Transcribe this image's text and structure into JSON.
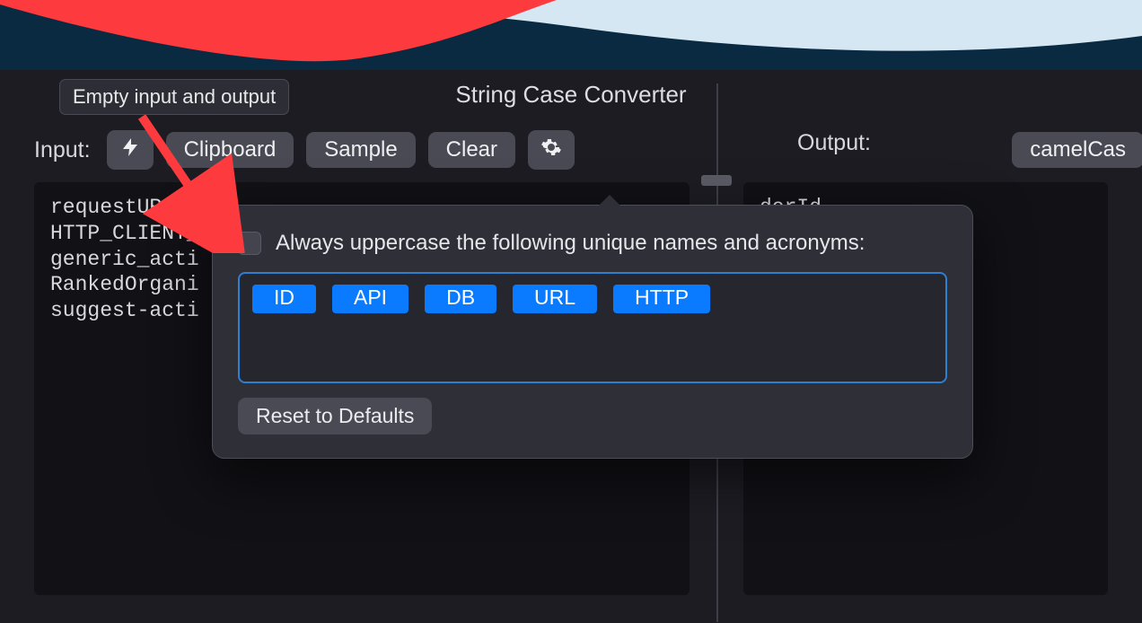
{
  "window": {
    "title": "String Case Converter"
  },
  "tooltip": "Empty input and output",
  "toolbar": {
    "input_label": "Input:",
    "clipboard": "Clipboard",
    "sample": "Sample",
    "clear": "Clear",
    "output_label": "Output:",
    "case_mode": "camelCas"
  },
  "icons": {
    "lightning": "lightning-icon",
    "gear": "gear-icon"
  },
  "input_text": "requestURLDe\nHTTP_CLIENT_\ngeneric_acti\nRankedOrgani\nsuggest-acti",
  "output_text": "derId\nry\nHighlights\neet\nFeed",
  "popover": {
    "checkbox_label": "Always uppercase the following unique names and acronyms:",
    "tokens": [
      "ID",
      "API",
      "DB",
      "URL",
      "HTTP"
    ],
    "reset": "Reset to Defaults"
  },
  "colors": {
    "accent": "#0a7aff",
    "annotation_red": "#fd3a3d"
  }
}
